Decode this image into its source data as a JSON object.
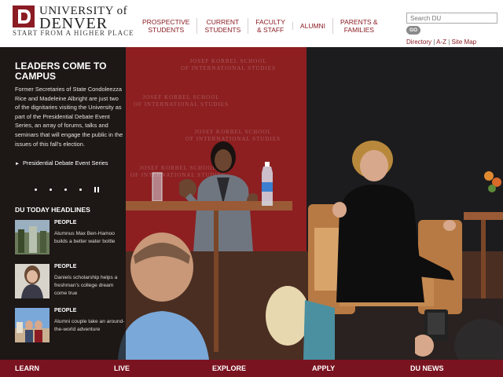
{
  "brand": {
    "university_line": "UNIVERSITY of",
    "name_line": "DENVER",
    "tagline": "START FROM A HIGHER PLACE",
    "accent": "#8b1c24"
  },
  "nav": {
    "items": [
      {
        "label": "PROSPECTIVE\nSTUDENTS"
      },
      {
        "label": "CURRENT\nSTUDENTS"
      },
      {
        "label": "FACULTY\n& STAFF"
      },
      {
        "label": "ALUMNI"
      },
      {
        "label": "PARENTS &\nFAMILIES"
      }
    ]
  },
  "search": {
    "placeholder": "Search DU",
    "go_label": "GO"
  },
  "util_links": {
    "directory": "Directory",
    "az": "A-Z",
    "sitemap": "Site Map",
    "separator": "|"
  },
  "hero": {
    "backdrop_text": "JOSEF KORBEL SCHOOL\nof INTERNATIONAL STUDIES",
    "feature": {
      "title": "LEADERS COME TO CAMPUS",
      "body": "Former Secretaries of State Condoleezza Rice and Madeleine Albright are just two of the dignitaries visiting the University as part of the Presidential Debate Event Series, an array of forums, talks and seminars that will engage the public in the issues of this fall's election.",
      "link": "Presidential Debate Event Series"
    },
    "pager_count": 4
  },
  "headlines": {
    "title": "DU TODAY HEADLINES",
    "items": [
      {
        "category": "PEOPLE",
        "text": "Alumnus Max Ben-Hamoo builds a better water bottle"
      },
      {
        "category": "PEOPLE",
        "text": "Daniels scholarship helps a freshman's college dream come true"
      },
      {
        "category": "PEOPLE",
        "text": "Alumni couple take an around-the-world adventure"
      }
    ]
  },
  "bottom_nav": {
    "items": [
      "LEARN",
      "LIVE",
      "EXPLORE",
      "APPLY",
      "DU NEWS"
    ]
  }
}
